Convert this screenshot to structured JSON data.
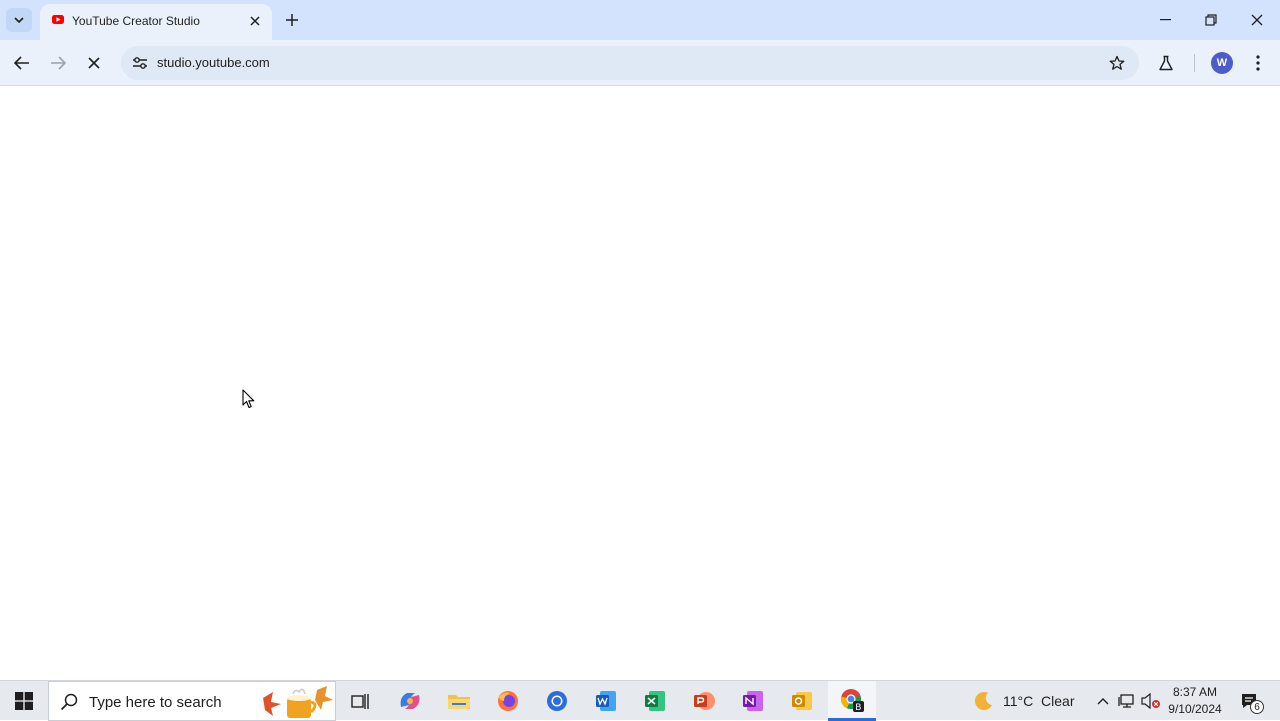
{
  "browser": {
    "tab": {
      "title": "YouTube Creator Studio",
      "favicon": "youtube-icon"
    },
    "omnibox": {
      "url": "studio.youtube.com"
    },
    "profile_initial": "W"
  },
  "taskbar": {
    "search_placeholder": "Type here to search",
    "apps": [
      "task-view",
      "copilot",
      "file-explorer",
      "firefox",
      "chrome-canary",
      "word",
      "excel",
      "powerpoint",
      "onenote",
      "outlook",
      "chrome"
    ],
    "active_app": "chrome",
    "weather": {
      "temp": "11°C",
      "condition": "Clear"
    },
    "clock": {
      "time": "8:37 AM",
      "date": "9/10/2024"
    },
    "notification_count": "6"
  },
  "colors": {
    "tabstrip": "#d3e3fd",
    "toolbar": "#eaf1fb",
    "accent": "#2f6bd8"
  }
}
